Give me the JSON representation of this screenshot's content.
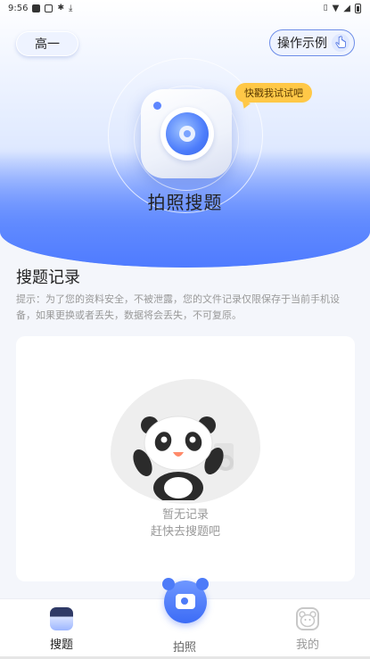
{
  "status_bar": {
    "time": "9:56"
  },
  "header": {
    "grade_label": "高一",
    "demo_label": "操作示例",
    "bubble_text": "快戳我试试吧",
    "title": "拍照搜题"
  },
  "history": {
    "title": "搜题记录",
    "tip": "提示：为了您的资料安全，不被泄露，您的文件记录仅限保存于当前手机设备，如果更换或者丢失，数据将会丢失，不可复原。",
    "empty_line1": "暂无记录",
    "empty_line2": "赶快去搜题吧"
  },
  "bottom_nav": {
    "items": [
      {
        "label": "搜题",
        "icon": "search-question-icon",
        "active": true
      },
      {
        "label": "拍照",
        "icon": "camera-icon",
        "active": false
      },
      {
        "label": "我的",
        "icon": "profile-icon",
        "active": false
      }
    ]
  },
  "colors": {
    "accent": "#4f7bff",
    "bubble": "#ffc847",
    "muted_text": "#999999"
  }
}
